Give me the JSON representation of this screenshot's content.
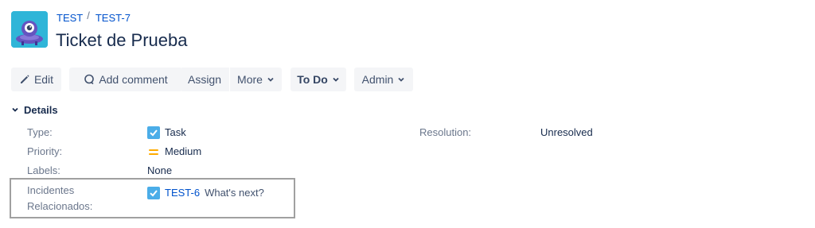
{
  "breadcrumb": {
    "project": "TEST",
    "separator": "/",
    "issue_key": "TEST-7"
  },
  "issue": {
    "title": "Ticket de Prueba"
  },
  "toolbar": {
    "edit": "Edit",
    "add_comment": "Add comment",
    "assign": "Assign",
    "more": "More",
    "status": "To Do",
    "admin": "Admin"
  },
  "details": {
    "header": "Details",
    "type": {
      "label": "Type:",
      "value": "Task",
      "icon": "task-icon"
    },
    "priority": {
      "label": "Priority:",
      "value": "Medium",
      "icon": "priority-medium-icon"
    },
    "labels": {
      "label": "Labels:",
      "value": "None"
    },
    "resolution": {
      "label": "Resolution:",
      "value": "Unresolved"
    },
    "linked": {
      "label_line1": "Incidentes",
      "label_line2": "Relacionados:",
      "key": "TEST-6",
      "summary": "What's next?",
      "icon": "task-icon"
    }
  },
  "colors": {
    "link": "#0052cc",
    "task_icon": "#4bade8",
    "priority_medium": "#ffab00",
    "button_bg": "#f4f5f7",
    "highlight_border": "#a0a0a0"
  }
}
